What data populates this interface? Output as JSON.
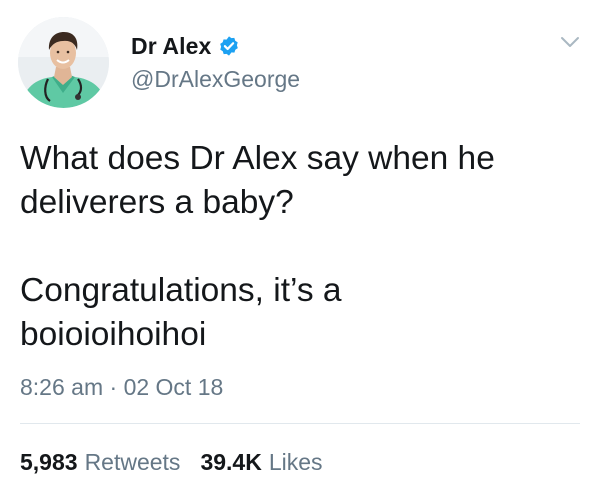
{
  "author": {
    "display_name": "Dr Alex",
    "handle": "@DrAlexGeorge",
    "verified": true,
    "verified_color": "#1da1f2",
    "avatar": "profile-photo"
  },
  "tweet": {
    "paragraphs": [
      "What does Dr Alex say when he\ndeliverers a baby?",
      "Congratulations, it’s a\nboioioihoihoi"
    ],
    "time": "8:26 am",
    "separator": "·",
    "date": "02 Oct 18"
  },
  "stats": {
    "retweets_count": "5,983",
    "retweets_label": "Retweets",
    "likes_count": "39.4K",
    "likes_label": "Likes"
  },
  "colors": {
    "text_primary": "#14171a",
    "text_secondary": "#657786",
    "divider": "#e1e8ed",
    "scrubs": "#5fc9a4"
  },
  "icons": {
    "verified": "verified-badge-icon",
    "menu": "chevron-down-icon"
  }
}
